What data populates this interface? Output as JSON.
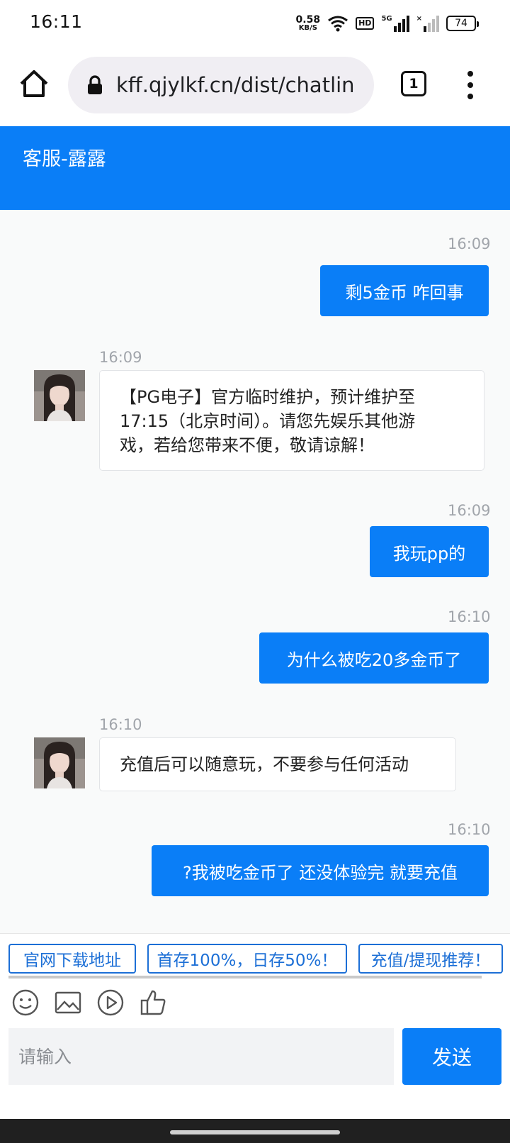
{
  "status_bar": {
    "time": "16:11",
    "net_speed_value": "0.58",
    "net_speed_unit": "KB/S",
    "hd_label": "HD",
    "signal_label": "5G",
    "battery": "74"
  },
  "browser": {
    "url": "kff.qjylkf.cn/dist/chatlin",
    "tab_count": "1"
  },
  "chat": {
    "title": "客服-露露",
    "messages": [
      {
        "from": "user",
        "time": "16:09",
        "text": "剩5金币 咋回事"
      },
      {
        "from": "agent",
        "time": "16:09",
        "lines": [
          "【PG电子】官方临时维护，预计维护至",
          "17:15（北京时间）。请您先娱乐其他游",
          "戏，若给您带来不便，敬请谅解！"
        ]
      },
      {
        "from": "user",
        "time": "16:09",
        "text": "我玩pp的"
      },
      {
        "from": "user",
        "time": "16:10",
        "text": "为什么被吃20多金币了"
      },
      {
        "from": "agent",
        "time": "16:10",
        "text": "充值后可以随意玩，不要参与任何活动"
      },
      {
        "from": "user",
        "time": "16:10",
        "text": "?我被吃金币了 还没体验完 就要充值"
      }
    ]
  },
  "quick_replies": [
    "官网下载地址",
    "首存100%，日存50%！",
    "充值/提现推荐！"
  ],
  "toolbar": {
    "icons": [
      "emoji-icon",
      "image-icon",
      "video-icon",
      "thumbs-up-icon"
    ]
  },
  "composer": {
    "placeholder": "请输入",
    "send_label": "发送"
  },
  "colors": {
    "accent": "#0a7ef7",
    "chat_bg": "#f9fafa",
    "quick_border": "#1c6fd6"
  }
}
